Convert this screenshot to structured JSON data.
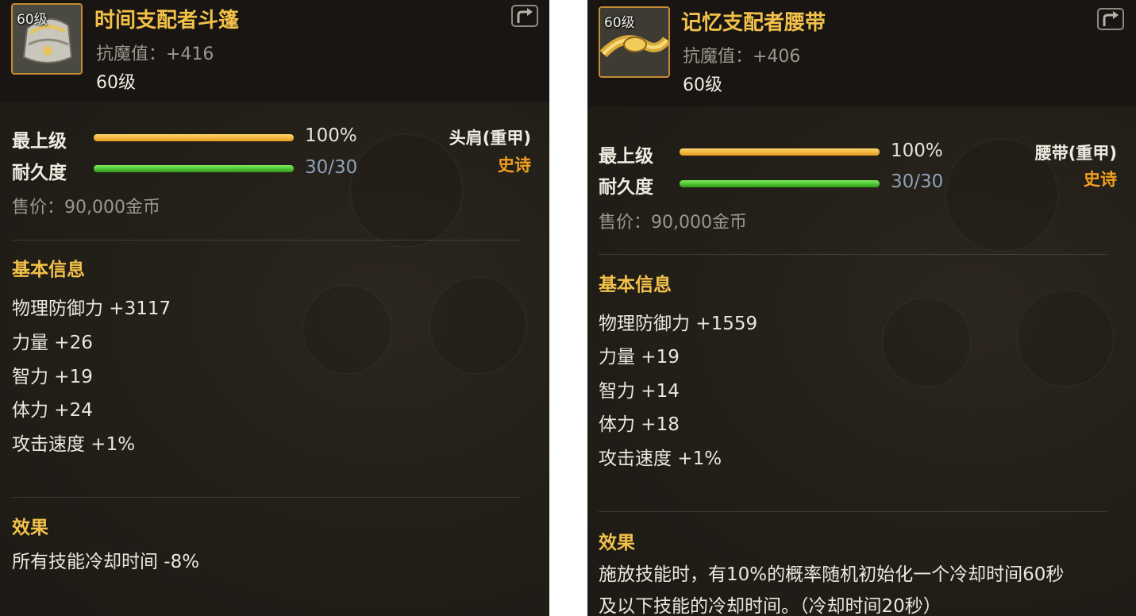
{
  "left": {
    "icon_level": "60级",
    "title": "时间支配者斗篷",
    "resist": "抗魔值：+416",
    "level": "60级",
    "grade_label": "最上级",
    "grade_pct": "100%",
    "grade_fraction": 1.0,
    "durability_label": "耐久度",
    "durability_value": "30/30",
    "durability_fraction": 1.0,
    "equip_type": "头肩(重甲)",
    "rarity": "史诗",
    "price": "售价：90,000金币",
    "basic_title": "基本信息",
    "stats": [
      "物理防御力 +3117",
      "力量 +26",
      "智力 +19",
      "体力 +24",
      "攻击速度 +1%"
    ],
    "effect_title": "效果",
    "effect_lines": [
      "所有技能冷却时间 -8%"
    ]
  },
  "right": {
    "icon_level": "60级",
    "title": "记忆支配者腰带",
    "resist": "抗魔值：+406",
    "level": "60级",
    "grade_label": "最上级",
    "grade_pct": "100%",
    "grade_fraction": 1.0,
    "durability_label": "耐久度",
    "durability_value": "30/30",
    "durability_fraction": 1.0,
    "equip_type": "腰带(重甲)",
    "rarity": "史诗",
    "price": "售价：90,000金币",
    "basic_title": "基本信息",
    "stats": [
      "物理防御力 +1559",
      "力量 +19",
      "智力 +14",
      "体力 +18",
      "攻击速度 +1%"
    ],
    "effect_title": "效果",
    "effect_lines": [
      "施放技能时，有10%的概率随机初始化一个冷却时间60秒",
      "及以下技能的冷却时间。（冷却时间20秒）"
    ]
  },
  "icons": {
    "left_item": "shoulder-armor-icon",
    "right_item": "belt-icon",
    "share": "share-arrow-icon"
  },
  "colors": {
    "title": "#f2c14a",
    "rarity_epic": "#f0a020",
    "grade_bar": "#e8a526",
    "durability_bar": "#4ccf2c"
  }
}
